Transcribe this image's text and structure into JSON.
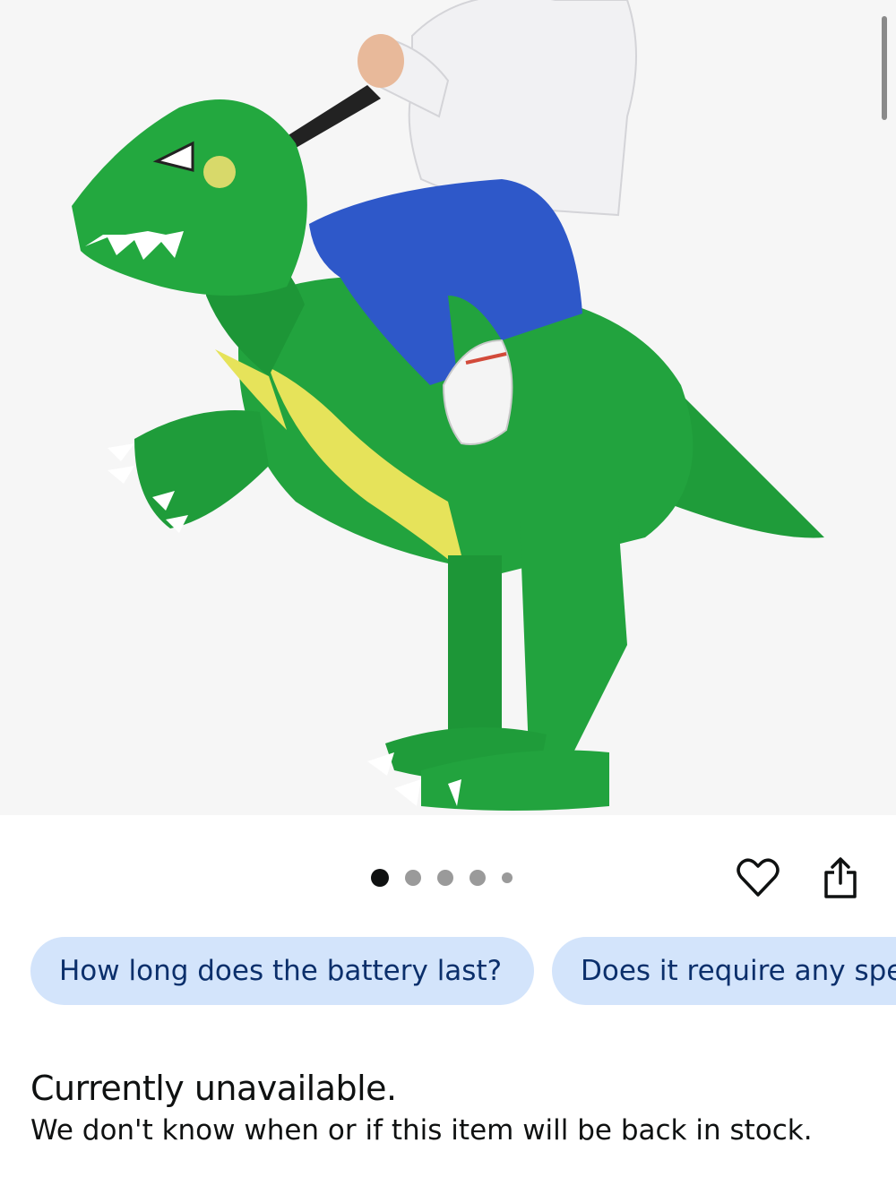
{
  "product_image": {
    "icon": "inflatable-dinosaur-costume-photo"
  },
  "carousel": {
    "total": 5,
    "active_index": 0
  },
  "actions": {
    "favorite_icon": "heart-icon",
    "share_icon": "share-icon"
  },
  "questions": [
    {
      "label": "How long does the battery last?"
    },
    {
      "label": "Does it require any spe"
    }
  ],
  "availability": {
    "title": "Currently unavailable.",
    "message": "We don't know when or if this item will be back in stock."
  },
  "colors": {
    "chip_bg": "#d3e4fb",
    "chip_text": "#0b2f6b",
    "costume_green": "#1f9c3a"
  }
}
